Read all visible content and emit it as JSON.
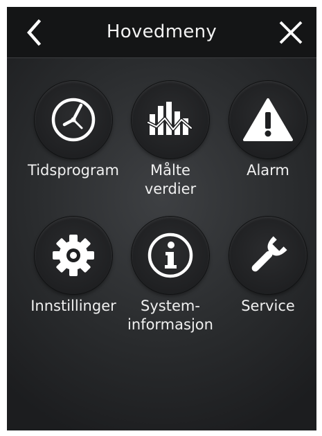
{
  "header": {
    "title": "Hovedmeny",
    "back_icon": "chevron-left-icon",
    "close_icon": "close-icon"
  },
  "menu": {
    "items": [
      {
        "id": "tidsprogram",
        "icon": "clock-icon",
        "line1": "Tidsprogram",
        "line2": ""
      },
      {
        "id": "malte-verdier",
        "icon": "chart-icon",
        "line1": "Målte",
        "line2": "verdier"
      },
      {
        "id": "alarm",
        "icon": "warning-icon",
        "line1": "Alarm",
        "line2": ""
      },
      {
        "id": "innstillinger",
        "icon": "gear-icon",
        "line1": "Innstillinger",
        "line2": ""
      },
      {
        "id": "systeminformasjon",
        "icon": "info-icon",
        "line1": "System-",
        "line2": "informasjon"
      },
      {
        "id": "service",
        "icon": "wrench-icon",
        "line1": "Service",
        "line2": ""
      }
    ]
  },
  "colors": {
    "header_bg": "#141516",
    "screen_bg": "#2a2c2e",
    "text": "#f0f0f0"
  }
}
